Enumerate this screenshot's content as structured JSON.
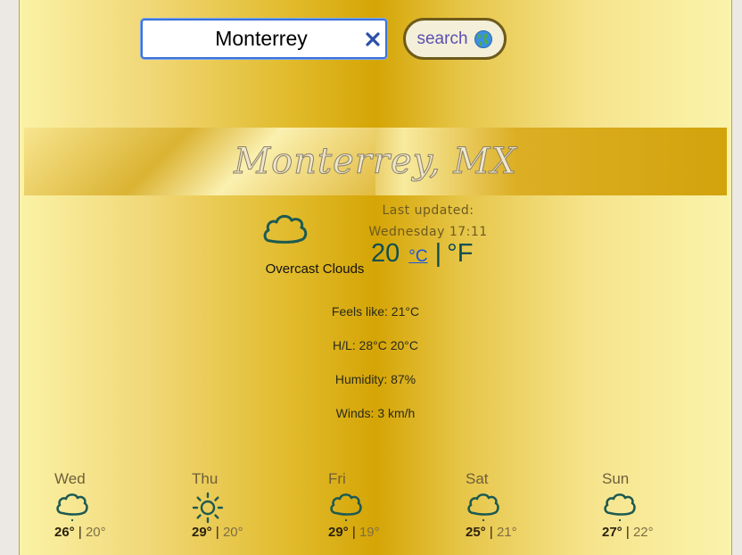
{
  "search": {
    "value": "Monterrey",
    "button_label": "search",
    "button_icon": "globe-icon"
  },
  "city_title": "Monterrey, MX",
  "current": {
    "icon": "cloud-icon",
    "description": "Overcast Clouds",
    "last_updated_label": "Last updated:",
    "last_updated_time": "Wednesday 17:11",
    "temperature": "20",
    "unit_c": "°C",
    "unit_separator": "|",
    "unit_f": "°F",
    "feels_like": "Feels like: 21°C",
    "high_low": "H/L: 28°C 20°C",
    "humidity": "Humidity: 87%",
    "winds": "Winds: 3 km/h"
  },
  "forecast": [
    {
      "day": "Wed",
      "icon": "cloud-icon",
      "high": "26°",
      "low": "20°"
    },
    {
      "day": "Thu",
      "icon": "sun-icon",
      "high": "29°",
      "low": "20°"
    },
    {
      "day": "Fri",
      "icon": "cloud-icon",
      "high": "29°",
      "low": "19°"
    },
    {
      "day": "Sat",
      "icon": "cloud-icon",
      "high": "25°",
      "low": "21°"
    },
    {
      "day": "Sun",
      "icon": "cloud-icon",
      "high": "27°",
      "low": "22°"
    }
  ],
  "forecast_separator": "|",
  "colors": {
    "accent": "#0e4e52",
    "link": "#1a55e3",
    "gold": "#d5a506"
  }
}
